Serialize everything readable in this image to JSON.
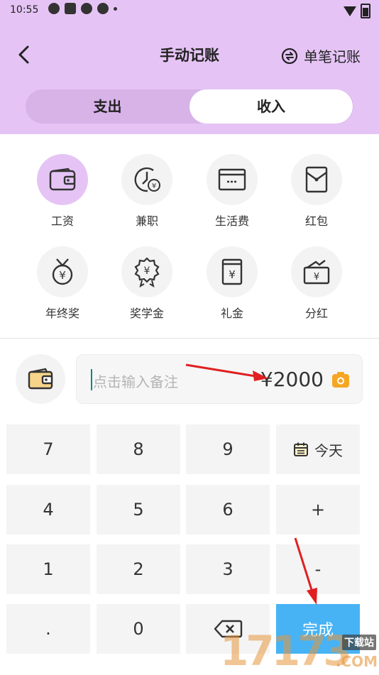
{
  "status_bar": {
    "time": "10:55"
  },
  "header": {
    "title": "手动记账",
    "single_entry": "单笔记账"
  },
  "segment": {
    "expense": "支出",
    "income": "收入"
  },
  "categories": [
    {
      "label": "工资",
      "icon": "wallet-icon"
    },
    {
      "label": "兼职",
      "icon": "clock-yen-icon"
    },
    {
      "label": "生活费",
      "icon": "card-icon"
    },
    {
      "label": "红包",
      "icon": "red-envelope-icon"
    },
    {
      "label": "年终奖",
      "icon": "medal-yen-icon"
    },
    {
      "label": "奖学金",
      "icon": "badge-yen-icon"
    },
    {
      "label": "礼金",
      "icon": "gift-money-icon"
    },
    {
      "label": "分红",
      "icon": "dividend-icon"
    }
  ],
  "input": {
    "placeholder": "点击输入备注",
    "amount": "¥2000"
  },
  "keypad": {
    "k7": "7",
    "k8": "8",
    "k9": "9",
    "today": "今天",
    "k4": "4",
    "k5": "5",
    "k6": "6",
    "plus": "+",
    "k1": "1",
    "k2": "2",
    "k3": "3",
    "minus": "-",
    "dot": ".",
    "k0": "0",
    "done": "完成"
  },
  "watermark": {
    "number": "17173",
    "site": "下载站",
    "suffix": ".COM"
  },
  "colors": {
    "header_bg": "#e5c4f5",
    "done_button": "#47b3f5",
    "amount_camera": "#f5a623",
    "annotation_arrow": "#e02020"
  }
}
